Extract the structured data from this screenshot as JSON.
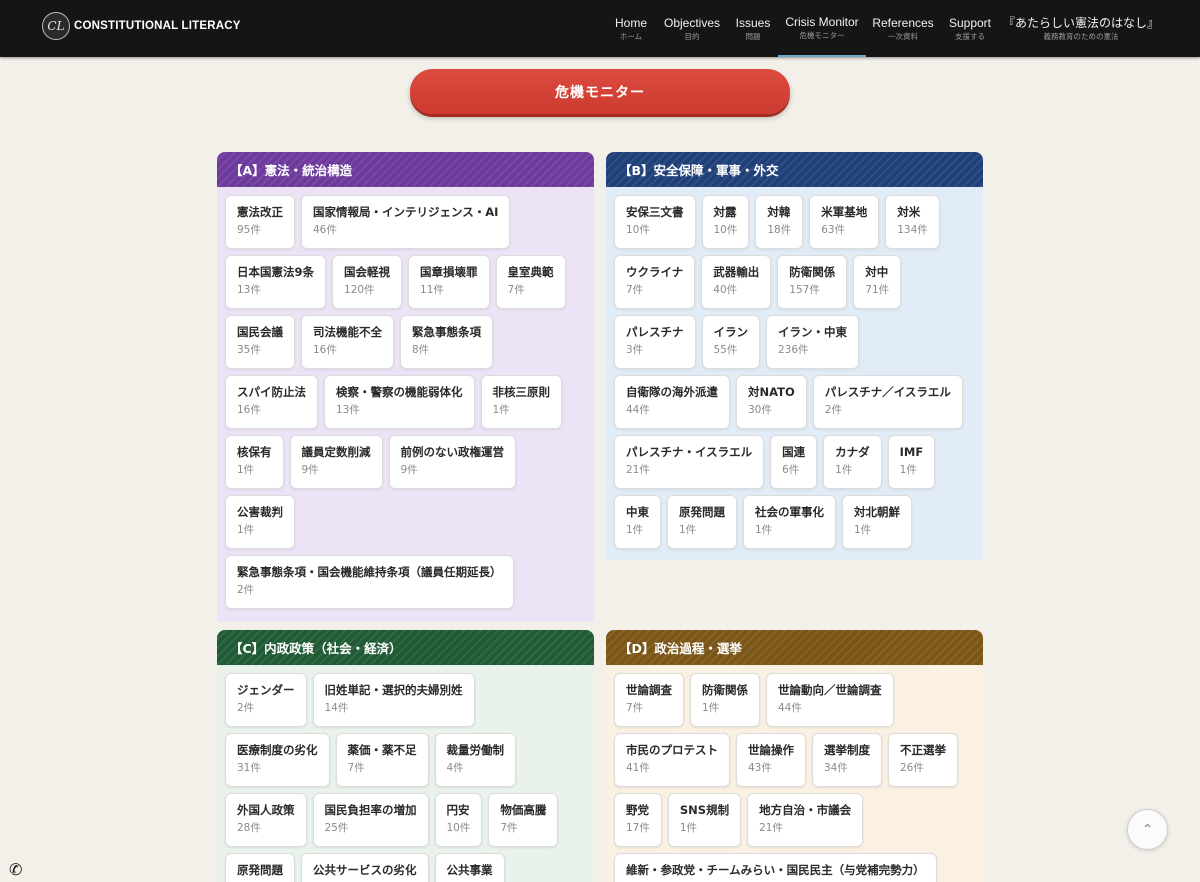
{
  "brand": {
    "logo_text": "CL",
    "name": "CONSTITUTIONAL LITERACY"
  },
  "nav": [
    {
      "en": "Home",
      "jp": "ホーム"
    },
    {
      "en": "Objectives",
      "jp": "目的"
    },
    {
      "en": "Issues",
      "jp": "問題"
    },
    {
      "en": "Crisis Monitor",
      "jp": "危機モニター"
    },
    {
      "en": "References",
      "jp": "一次資料"
    },
    {
      "en": "Support",
      "jp": "支援する"
    },
    {
      "en": "『あたらしい憲法のはなし』",
      "jp": "義務教育のための憲法"
    }
  ],
  "active_nav": "Crisis Monitor",
  "banner_label": "危機モニター",
  "colors": {
    "header_bg": "#151515",
    "banner_red": "#d8443a",
    "A": "#6d3a9c",
    "A_bg": "#ece4f6",
    "B": "#1e3f78",
    "B_bg": "#e2ecf7",
    "C": "#1f5a34",
    "C_bg": "#e9f3ec",
    "D": "#7a5516",
    "D_bg": "#fbf1e2"
  },
  "panels": {
    "A": {
      "title": "【A】憲法・統治構造",
      "tags": [
        {
          "name": "憲法改正",
          "count": "95件"
        },
        {
          "name": "国家情報局・インテリジェンス・AI",
          "count": "46件"
        },
        {
          "name": "日本国憲法9条",
          "count": "13件"
        },
        {
          "name": "国会軽視",
          "count": "120件"
        },
        {
          "name": "国章損壊罪",
          "count": "11件"
        },
        {
          "name": "皇室典範",
          "count": "7件"
        },
        {
          "name": "国民会議",
          "count": "35件"
        },
        {
          "name": "司法機能不全",
          "count": "16件"
        },
        {
          "name": "緊急事態条項",
          "count": "8件"
        },
        {
          "name": "スパイ防止法",
          "count": "16件"
        },
        {
          "name": "検察・警察の機能弱体化",
          "count": "13件"
        },
        {
          "name": "非核三原則",
          "count": "1件"
        },
        {
          "name": "核保有",
          "count": "1件"
        },
        {
          "name": "議員定数削減",
          "count": "9件"
        },
        {
          "name": "前例のない政権運営",
          "count": "9件"
        },
        {
          "name": "公害裁判",
          "count": "1件"
        },
        {
          "name": "緊急事態条項・国会機能維持条項（議員任期延長）",
          "count": "2件"
        }
      ]
    },
    "B": {
      "title": "【B】安全保障・軍事・外交",
      "tags": [
        {
          "name": "安保三文書",
          "count": "10件"
        },
        {
          "name": "対露",
          "count": "10件"
        },
        {
          "name": "対韓",
          "count": "18件"
        },
        {
          "name": "米軍基地",
          "count": "63件"
        },
        {
          "name": "対米",
          "count": "134件"
        },
        {
          "name": "ウクライナ",
          "count": "7件"
        },
        {
          "name": "武器輸出",
          "count": "40件"
        },
        {
          "name": "防衛関係",
          "count": "157件"
        },
        {
          "name": "対中",
          "count": "71件"
        },
        {
          "name": "パレスチナ",
          "count": "3件"
        },
        {
          "name": "イラン",
          "count": "55件"
        },
        {
          "name": "イラン・中東",
          "count": "236件"
        },
        {
          "name": "自衛隊の海外派遣",
          "count": "44件"
        },
        {
          "name": "対NATO",
          "count": "30件"
        },
        {
          "name": "パレスチナ／イスラエル",
          "count": "2件"
        },
        {
          "name": "パレスチナ・イスラエル",
          "count": "21件"
        },
        {
          "name": "国連",
          "count": "6件"
        },
        {
          "name": "カナダ",
          "count": "1件"
        },
        {
          "name": "IMF",
          "count": "1件"
        },
        {
          "name": "中東",
          "count": "1件"
        },
        {
          "name": "原発問題",
          "count": "1件"
        },
        {
          "name": "社会の軍事化",
          "count": "1件"
        },
        {
          "name": "対北朝鮮",
          "count": "1件"
        }
      ]
    },
    "C": {
      "title": "【C】内政政策（社会・経済）",
      "tags": [
        {
          "name": "ジェンダー",
          "count": "2件"
        },
        {
          "name": "旧姓単記・選択的夫婦別姓",
          "count": "14件"
        },
        {
          "name": "医療制度の劣化",
          "count": "31件"
        },
        {
          "name": "薬価・薬不足",
          "count": "7件"
        },
        {
          "name": "裁量労働制",
          "count": "4件"
        },
        {
          "name": "外国人政策",
          "count": "28件"
        },
        {
          "name": "国民負担率の増加",
          "count": "25件"
        },
        {
          "name": "円安",
          "count": "10件"
        },
        {
          "name": "物価高騰",
          "count": "7件"
        },
        {
          "name": "原発問題",
          "count": ""
        },
        {
          "name": "公共サービスの劣化",
          "count": ""
        },
        {
          "name": "公共事業",
          "count": ""
        }
      ]
    },
    "D": {
      "title": "【D】政治過程・選挙",
      "tags": [
        {
          "name": "世論調査",
          "count": "7件"
        },
        {
          "name": "防衛関係",
          "count": "1件"
        },
        {
          "name": "世論動向／世論調査",
          "count": "44件"
        },
        {
          "name": "市民のプロテスト",
          "count": "41件"
        },
        {
          "name": "世論操作",
          "count": "43件"
        },
        {
          "name": "選挙制度",
          "count": "34件"
        },
        {
          "name": "不正選挙",
          "count": "26件"
        },
        {
          "name": "野党",
          "count": "17件"
        },
        {
          "name": "SNS規制",
          "count": "1件"
        },
        {
          "name": "地方自治・市議会",
          "count": "21件"
        },
        {
          "name": "維新・参政党・チームみらい・国民民主（与党補完勢力）",
          "count": ""
        }
      ]
    }
  },
  "icons": {
    "scroll_top": "chevron-up-icon",
    "phone": "phone-icon"
  }
}
